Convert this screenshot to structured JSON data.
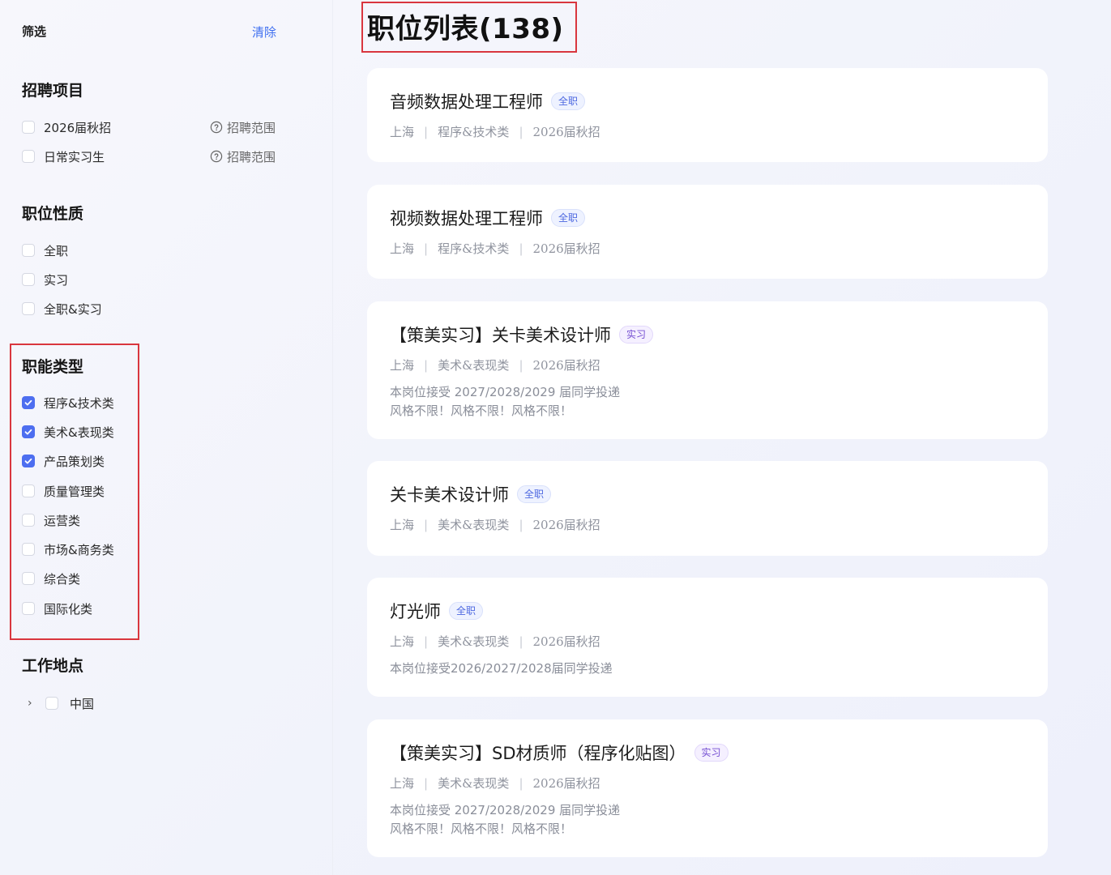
{
  "sidebar": {
    "filter_title": "筛选",
    "clear_label": "清除",
    "recruit_title": "招聘项目",
    "recruit_items": [
      {
        "label": "2026届秋招",
        "scope": "招聘范围",
        "checked": false
      },
      {
        "label": "日常实习生",
        "scope": "招聘范围",
        "checked": false
      }
    ],
    "nature_title": "职位性质",
    "nature_items": [
      {
        "label": "全职",
        "checked": false
      },
      {
        "label": "实习",
        "checked": false
      },
      {
        "label": "全职&实习",
        "checked": false
      }
    ],
    "function_title": "职能类型",
    "function_items": [
      {
        "label": "程序&技术类",
        "checked": true
      },
      {
        "label": "美术&表现类",
        "checked": true
      },
      {
        "label": "产品策划类",
        "checked": true
      },
      {
        "label": "质量管理类",
        "checked": false
      },
      {
        "label": "运营类",
        "checked": false
      },
      {
        "label": "市场&商务类",
        "checked": false
      },
      {
        "label": "综合类",
        "checked": false
      },
      {
        "label": "国际化类",
        "checked": false
      }
    ],
    "location_title": "工作地点",
    "location_items": [
      {
        "label": "中国",
        "checked": false
      }
    ]
  },
  "main": {
    "title": "职位列表(138)",
    "jobs": [
      {
        "title": "音频数据处理工程师",
        "tag": "全职",
        "city": "上海",
        "category": "程序&技术类",
        "batch": "2026届秋招",
        "desc": []
      },
      {
        "title": "视频数据处理工程师",
        "tag": "全职",
        "city": "上海",
        "category": "程序&技术类",
        "batch": "2026届秋招",
        "desc": []
      },
      {
        "title": "【策美实习】关卡美术设计师",
        "tag": "实习",
        "city": "上海",
        "category": "美术&表现类",
        "batch": "2026届秋招",
        "desc": [
          "本岗位接受 2027/2028/2029 届同学投递",
          "风格不限！风格不限！风格不限！"
        ]
      },
      {
        "title": "关卡美术设计师",
        "tag": "全职",
        "city": "上海",
        "category": "美术&表现类",
        "batch": "2026届秋招",
        "desc": []
      },
      {
        "title": "灯光师",
        "tag": "全职",
        "city": "上海",
        "category": "美术&表现类",
        "batch": "2026届秋招",
        "desc": [
          "本岗位接受2026/2027/2028届同学投递"
        ]
      },
      {
        "title": "【策美实习】SD材质师（程序化贴图）",
        "tag": "实习",
        "city": "上海",
        "category": "美术&表现类",
        "batch": "2026届秋招",
        "desc": [
          "本岗位接受 2027/2028/2029 届同学投递",
          "风格不限！风格不限！风格不限！"
        ]
      }
    ]
  },
  "colors": {
    "accent": "#4d6ef0",
    "highlight_box": "#d9363e",
    "tag_fulltime": "#4d68e0",
    "tag_intern": "#7650d2"
  }
}
